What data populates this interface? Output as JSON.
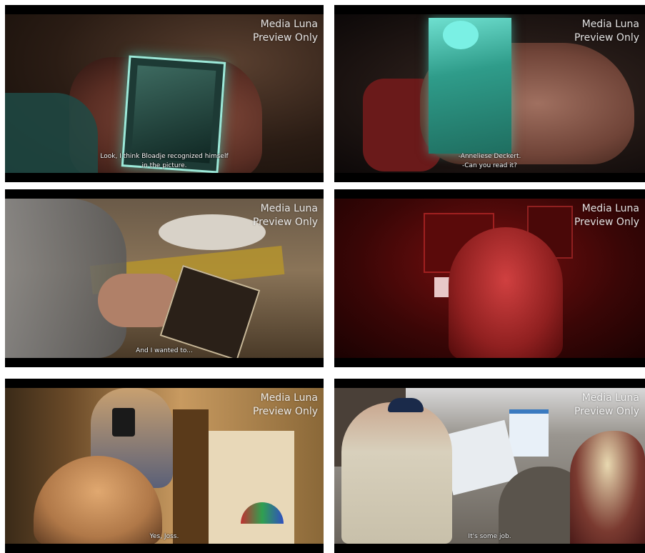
{
  "watermark": {
    "line1": "Media Luna",
    "line2": "Preview Only"
  },
  "frames": [
    {
      "subtitle": [
        "Look, I think Bloadje recognized himself",
        "in the picture."
      ]
    },
    {
      "subtitle": [
        "-Anneliese Deckert.",
        "-Can you read it?"
      ]
    },
    {
      "subtitle": [
        "And I wanted to..."
      ]
    },
    {
      "subtitle": []
    },
    {
      "subtitle": [
        "Yes, Joss."
      ]
    },
    {
      "subtitle": [
        "It's some job."
      ]
    }
  ]
}
